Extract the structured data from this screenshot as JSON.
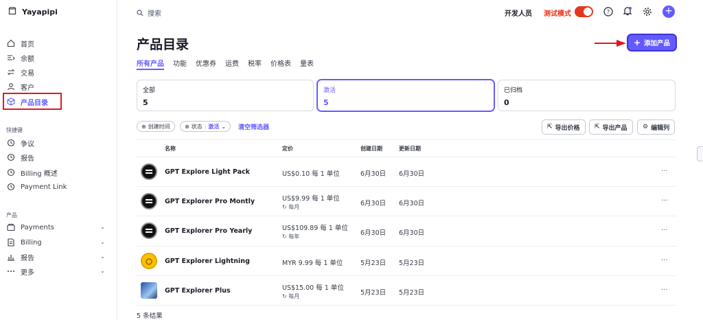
{
  "account": {
    "name": "Yayapipi"
  },
  "sidebar": {
    "items": [
      {
        "label": "首页"
      },
      {
        "label": "余额"
      },
      {
        "label": "交易"
      },
      {
        "label": "客户"
      },
      {
        "label": "产品目录"
      }
    ],
    "shortcuts_title": "快捷键",
    "shortcuts": [
      {
        "label": "争议"
      },
      {
        "label": "报告"
      },
      {
        "label": "Billing 概述"
      },
      {
        "label": "Payment Link"
      }
    ],
    "products_title": "产品",
    "products": [
      {
        "label": "Payments"
      },
      {
        "label": "Billing"
      },
      {
        "label": "报告"
      },
      {
        "label": "更多"
      }
    ]
  },
  "topbar": {
    "search_placeholder": "搜索",
    "developer_label": "开发人员",
    "test_mode_label": "测试模式"
  },
  "page": {
    "title": "产品目录",
    "add_button": "添加产品",
    "tabs": [
      {
        "label": "所有产品"
      },
      {
        "label": "功能"
      },
      {
        "label": "优惠券"
      },
      {
        "label": "运费"
      },
      {
        "label": "税率"
      },
      {
        "label": "价格表"
      },
      {
        "label": "量表"
      }
    ],
    "cards": [
      {
        "label": "全部",
        "value": "5"
      },
      {
        "label": "激活",
        "value": "5"
      },
      {
        "label": "已归档",
        "value": "0"
      }
    ],
    "filters": {
      "created": "创建时间",
      "status_label": "状态",
      "status_value": "激活",
      "clear": "清空筛选器"
    },
    "actions": {
      "export_prices": "导出价格",
      "export_products": "导出产品",
      "edit_columns": "编辑列"
    },
    "table": {
      "headers": {
        "name": "名称",
        "price": "定价",
        "created": "创建日期",
        "updated": "更新日期"
      },
      "rows": [
        {
          "name": "GPT Explore Light Pack",
          "price": "US$0.10 每 1 单位",
          "interval": "",
          "created": "6月30日",
          "updated": "6月30日"
        },
        {
          "name": "GPT Explorer Pro Montly",
          "price": "US$9.99 每 1 单位",
          "interval": "每月",
          "created": "6月30日",
          "updated": "6月30日"
        },
        {
          "name": "GPT Explorer Pro Yearly",
          "price": "US$109.89 每 1 单位",
          "interval": "每年",
          "created": "6月30日",
          "updated": "6月30日"
        },
        {
          "name": "GPT Explorer Lightning",
          "price": "MYR 9.99 每 1 单位",
          "interval": "",
          "created": "5月23日",
          "updated": "5月23日"
        },
        {
          "name": "GPT Explorer Plus",
          "price": "US$15.00 每 1 单位",
          "interval": "每月",
          "created": "5月23日",
          "updated": "5月23日"
        }
      ],
      "more": "···"
    },
    "results": "5 条结果"
  },
  "colors": {
    "accent": "#635bff",
    "test_mode": "#e5381b",
    "highlight": "#e4151f"
  }
}
